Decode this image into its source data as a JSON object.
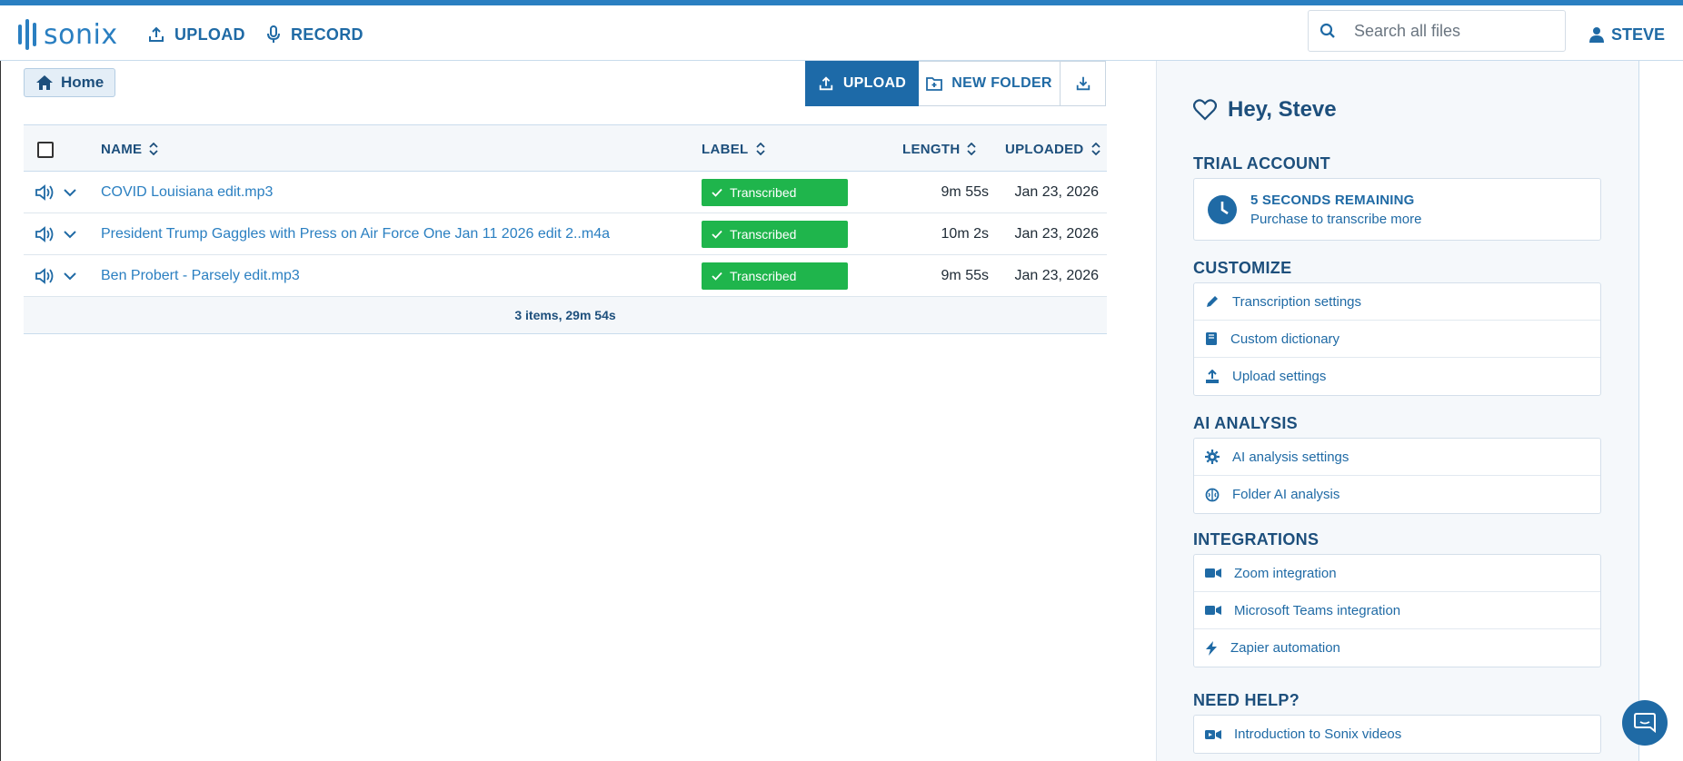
{
  "app": {
    "logo_text": "sonix"
  },
  "nav": {
    "upload_label": "UPLOAD",
    "record_label": "RECORD",
    "user_label": "STEVE"
  },
  "search": {
    "placeholder": "Search all files"
  },
  "breadcrumb": {
    "home_label": "Home"
  },
  "toolbar": {
    "upload_label": "UPLOAD",
    "new_folder_label": "NEW FOLDER"
  },
  "table": {
    "headers": {
      "name": "NAME",
      "label": "LABEL",
      "length": "LENGTH",
      "uploaded": "UPLOADED"
    },
    "rows": [
      {
        "name": "COVID Louisiana edit.mp3",
        "label": "Transcribed",
        "length": "9m 55s",
        "uploaded": "Jan 23, 2026"
      },
      {
        "name": "President Trump Gaggles with Press on Air Force One Jan 11 2026 edit 2..m4a",
        "label": "Transcribed",
        "length": "10m 2s",
        "uploaded": "Jan 23, 2026"
      },
      {
        "name": "Ben Probert - Parsely edit.mp3",
        "label": "Transcribed",
        "length": "9m 55s",
        "uploaded": "Jan 23, 2026"
      }
    ],
    "summary": "3 items, 29m 54s"
  },
  "sidebar": {
    "greeting": "Hey, Steve",
    "trial": {
      "title": "TRIAL ACCOUNT",
      "remaining": "5 SECONDS REMAINING",
      "cta": "Purchase to transcribe more"
    },
    "customize": {
      "title": "CUSTOMIZE",
      "items": [
        "Transcription settings",
        "Custom dictionary",
        "Upload settings"
      ]
    },
    "ai": {
      "title": "AI ANALYSIS",
      "items": [
        "AI analysis settings",
        "Folder AI analysis"
      ]
    },
    "integrations": {
      "title": "INTEGRATIONS",
      "items": [
        "Zoom integration",
        "Microsoft Teams integration",
        "Zapier automation"
      ]
    },
    "help": {
      "title": "NEED HELP?",
      "items": [
        "Introduction to Sonix videos"
      ]
    }
  },
  "colors": {
    "brand": "#2a7fc1",
    "primary_button": "#1d6aa8",
    "badge_green": "#1fb54c",
    "heading": "#1d4f7c"
  },
  "icons": [
    "upload-icon",
    "microphone-icon",
    "search-icon",
    "user-icon",
    "home-icon",
    "new-folder-icon",
    "download-icon",
    "sort-icon",
    "speaker-icon",
    "chevron-down-icon",
    "check-icon",
    "heart-icon",
    "clock-icon",
    "pen-icon",
    "book-icon",
    "upload-settings-icon",
    "gear-icon",
    "brain-icon",
    "video-icon",
    "bolt-icon",
    "chat-icon"
  ]
}
